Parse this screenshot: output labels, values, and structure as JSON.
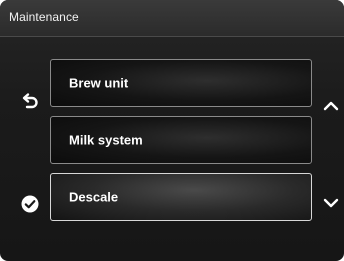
{
  "header": {
    "title": "Maintenance"
  },
  "menu": {
    "items": [
      {
        "label": "Brew unit",
        "selected": false
      },
      {
        "label": "Milk system",
        "selected": false
      },
      {
        "label": "Descale",
        "selected": true
      }
    ]
  },
  "icons": {
    "back": "back-arrow-icon",
    "confirm": "checkmark-circle-icon",
    "scroll_up": "chevron-up-icon",
    "scroll_down": "chevron-down-icon"
  },
  "colors": {
    "background": "#1b1b1b",
    "header": "#2f2f2f",
    "text": "#ffffff",
    "border": "#8a8a8a",
    "selected_border": "#d8d8d8"
  }
}
